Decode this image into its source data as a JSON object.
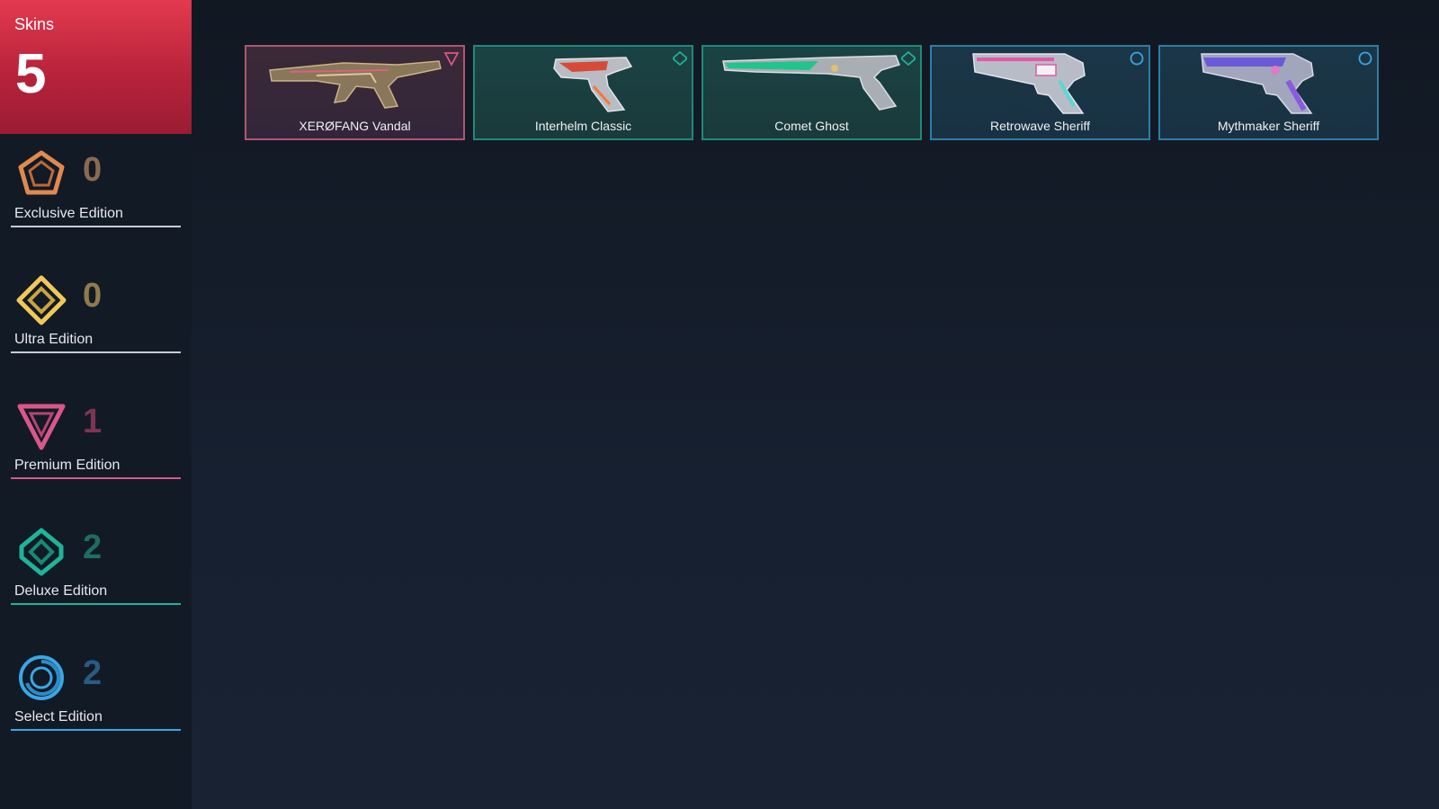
{
  "summary": {
    "label": "Skins",
    "total": "5"
  },
  "tiers": [
    {
      "name": "Exclusive Edition",
      "count": "0",
      "icon": "exclusive-edition-icon",
      "color": "#e08a4e",
      "count_color": "#8a6a52"
    },
    {
      "name": "Ultra Edition",
      "count": "0",
      "icon": "ultra-edition-icon",
      "color": "#f0c95a",
      "count_color": "#8f7c4a"
    },
    {
      "name": "Premium Edition",
      "count": "1",
      "icon": "premium-edition-icon",
      "color": "#d9578a",
      "count_color": "#7c3552"
    },
    {
      "name": "Deluxe Edition",
      "count": "2",
      "icon": "deluxe-edition-icon",
      "color": "#1fb39a",
      "count_color": "#1f6c63"
    },
    {
      "name": "Select Edition",
      "count": "2",
      "icon": "select-edition-icon",
      "color": "#3aa6e6",
      "count_color": "#285c80"
    }
  ],
  "skins": [
    {
      "name": "XERØFANG Vandal",
      "tier": "premium",
      "icon": "premium-edition-icon"
    },
    {
      "name": "Interhelm Classic",
      "tier": "deluxe",
      "icon": "deluxe-edition-icon"
    },
    {
      "name": "Comet Ghost",
      "tier": "deluxe",
      "icon": "deluxe-edition-icon"
    },
    {
      "name": "Retrowave Sheriff",
      "tier": "select",
      "icon": "select-edition-icon"
    },
    {
      "name": "Mythmaker Sheriff",
      "tier": "select",
      "icon": "select-edition-icon"
    }
  ]
}
